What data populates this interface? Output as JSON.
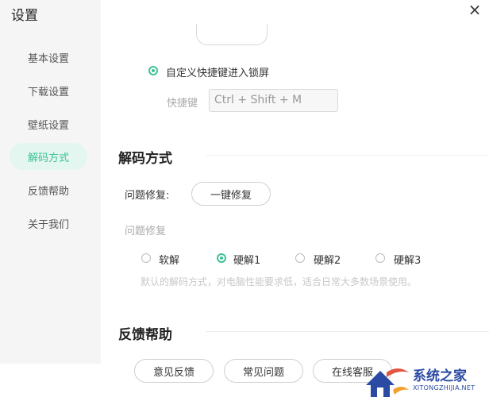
{
  "app": {
    "title": "设置",
    "close_glyph": "×"
  },
  "sidebar": {
    "items": [
      {
        "label": "基本设置",
        "active": false
      },
      {
        "label": "下载设置",
        "active": false
      },
      {
        "label": "壁纸设置",
        "active": false
      },
      {
        "label": "解码方式",
        "active": true
      },
      {
        "label": "反馈帮助",
        "active": false
      },
      {
        "label": "关于我们",
        "active": false
      }
    ]
  },
  "lock_screen": {
    "custom_shortcut_option": {
      "label": "自定义快捷键进入锁屏",
      "checked": true
    },
    "shortcut_label": "快捷键",
    "shortcut_value": "Ctrl + Shift + M"
  },
  "decode": {
    "title": "解码方式",
    "repair_label": "问题修复:",
    "repair_button": "一键修复",
    "repair_sub_label": "问题修复",
    "options": [
      {
        "label": "软解",
        "checked": false
      },
      {
        "label": "硬解1",
        "checked": true
      },
      {
        "label": "硬解2",
        "checked": false
      },
      {
        "label": "硬解3",
        "checked": false
      }
    ],
    "hint": "默认的解码方式，对电脑性能要求低，适合日常大多数场景使用。"
  },
  "feedback": {
    "title": "反馈帮助",
    "buttons": [
      "意见反馈",
      "常见问题",
      "在线客服"
    ]
  },
  "watermark": {
    "title": "系统之家",
    "subtitle": "XITONGZHIJIA.NET"
  },
  "colors": {
    "accent": "#3cc295",
    "active_bg": "#e3f6ef",
    "sidebar_bg": "#f5f5f5"
  },
  "icons": {
    "close": "close-icon",
    "watermark": "house-logo-icon"
  }
}
